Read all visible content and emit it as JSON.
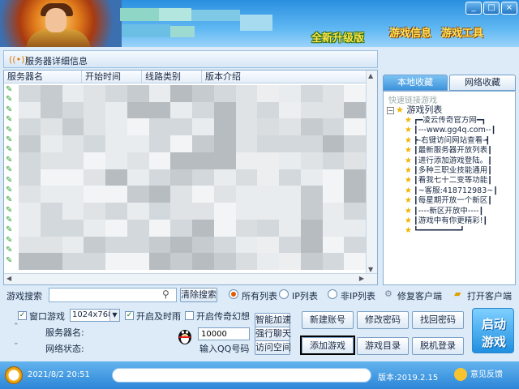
{
  "header": {
    "upgrade_label": "全新升级版",
    "game_info": "游戏信息",
    "game_tools": "游戏工具",
    "window_buttons": [
      "_",
      "□",
      "×"
    ]
  },
  "server_list": {
    "title": "服务器详细信息",
    "columns": [
      "服务器名",
      "开始时间",
      "线路类别",
      "版本介绍"
    ],
    "row_count": 18
  },
  "right_panel": {
    "tabs": [
      "本地收藏",
      "网络收藏"
    ],
    "quick_label": "快速链接游戏",
    "tree_root": "游戏列表",
    "items": [
      "┏━凌云传奇官方网━┓",
      "┃---www.gg4q.com--┃",
      "┣-右键访问网站查看-┫",
      "┃最新服务器开放列表┃",
      "┃进行添加游戏登陆。┃",
      "┃多种三职业技能通用┃",
      "┃看我七十二变等功能┃",
      "┃~客服:418712983~┃",
      "┃每星期开放一个新区┃",
      "┃----新区开放中----┃",
      "┃游戏中有你更精彩!┃",
      "┗━━━━━━━━━┛"
    ]
  },
  "search": {
    "label": "游戏搜索",
    "value": "",
    "clear_btn": "清除搜索",
    "radios": [
      {
        "label": "所有列表",
        "checked": true
      },
      {
        "label": "IP列表",
        "checked": false
      },
      {
        "label": "非IP列表",
        "checked": false
      }
    ],
    "repair_btn": "修复客户端",
    "open_btn": "打开客户端"
  },
  "bottom": {
    "window_mode": "窗口游戏",
    "window_mode_checked": true,
    "resolution": "1024x768",
    "enable_time": "开启及时雨",
    "enable_time_checked": true,
    "enable_illusion": "开启传奇幻想",
    "enable_illusion_checked": false,
    "server_name_label": "服务器名:",
    "network_label": "网络状态:",
    "qq_value": "10000",
    "qq_label": "输入QQ号码",
    "smart_accel": "智能加速",
    "force_chat": "强行聊天",
    "visit_space": "访问空间",
    "new_account": "新建账号",
    "change_password": "修改密码",
    "recover_password": "找回密码",
    "add_game": "添加游戏",
    "game_directory": "游戏目录",
    "offline_login": "脱机登录",
    "start_game": [
      "启动",
      "游戏"
    ]
  },
  "status": {
    "datetime": "2021/8/2 20:51",
    "version": "版本:2019.2.15",
    "feedback": "意见反馈"
  },
  "colors": {
    "accent": "#2c86d8",
    "highlight_border": "#000000",
    "title_gold": "#ffe65a"
  }
}
